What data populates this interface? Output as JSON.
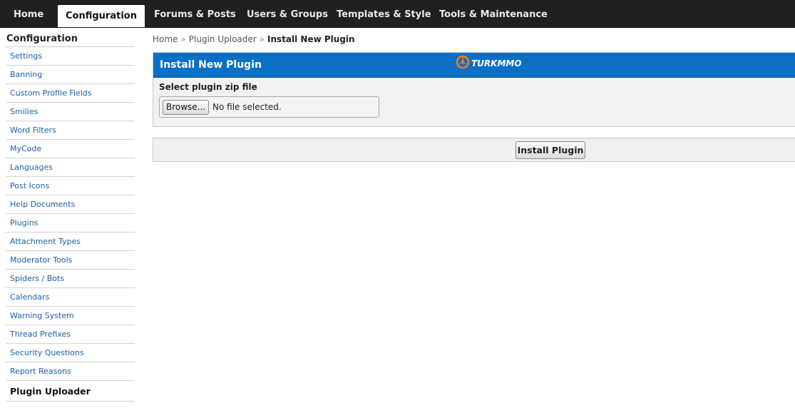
{
  "topnav": {
    "tabs": [
      {
        "label": "Home"
      },
      {
        "label": "Configuration"
      },
      {
        "label": "Forums & Posts"
      },
      {
        "label": "Users & Groups"
      },
      {
        "label": "Templates & Style"
      },
      {
        "label": "Tools & Maintenance"
      }
    ],
    "active": "Configuration"
  },
  "sidebar": {
    "title": "Configuration",
    "items": [
      {
        "label": "Settings"
      },
      {
        "label": "Banning"
      },
      {
        "label": "Custom Profile Fields"
      },
      {
        "label": "Smilies"
      },
      {
        "label": "Word Filters"
      },
      {
        "label": "MyCode"
      },
      {
        "label": "Languages"
      },
      {
        "label": "Post Icons"
      },
      {
        "label": "Help Documents"
      },
      {
        "label": "Plugins"
      },
      {
        "label": "Attachment Types"
      },
      {
        "label": "Moderator Tools"
      },
      {
        "label": "Spiders / Bots"
      },
      {
        "label": "Calendars"
      },
      {
        "label": "Warning System"
      },
      {
        "label": "Thread Prefixes"
      },
      {
        "label": "Security Questions"
      },
      {
        "label": "Report Reasons"
      },
      {
        "label": "Plugin Uploader"
      }
    ],
    "active": "Plugin Uploader"
  },
  "breadcrumb": {
    "items": [
      {
        "label": "Home"
      },
      {
        "label": "Plugin Uploader"
      }
    ],
    "separator": "»",
    "current": "Install New Plugin"
  },
  "panel": {
    "title": "Install New Plugin",
    "logo_text": "TURKMMO",
    "logo_icon": "turkmmo-logo-icon",
    "field_label": "Select plugin zip file",
    "file_input": {
      "button_label": "Browse...",
      "status": "No file selected."
    }
  },
  "submit": {
    "label": "Install Plugin"
  },
  "colors": {
    "topnav_bg": "#202020",
    "link": "#1c5ea8",
    "panel_header": "#0b6fc7",
    "logo_orange": "#f07a1a"
  }
}
